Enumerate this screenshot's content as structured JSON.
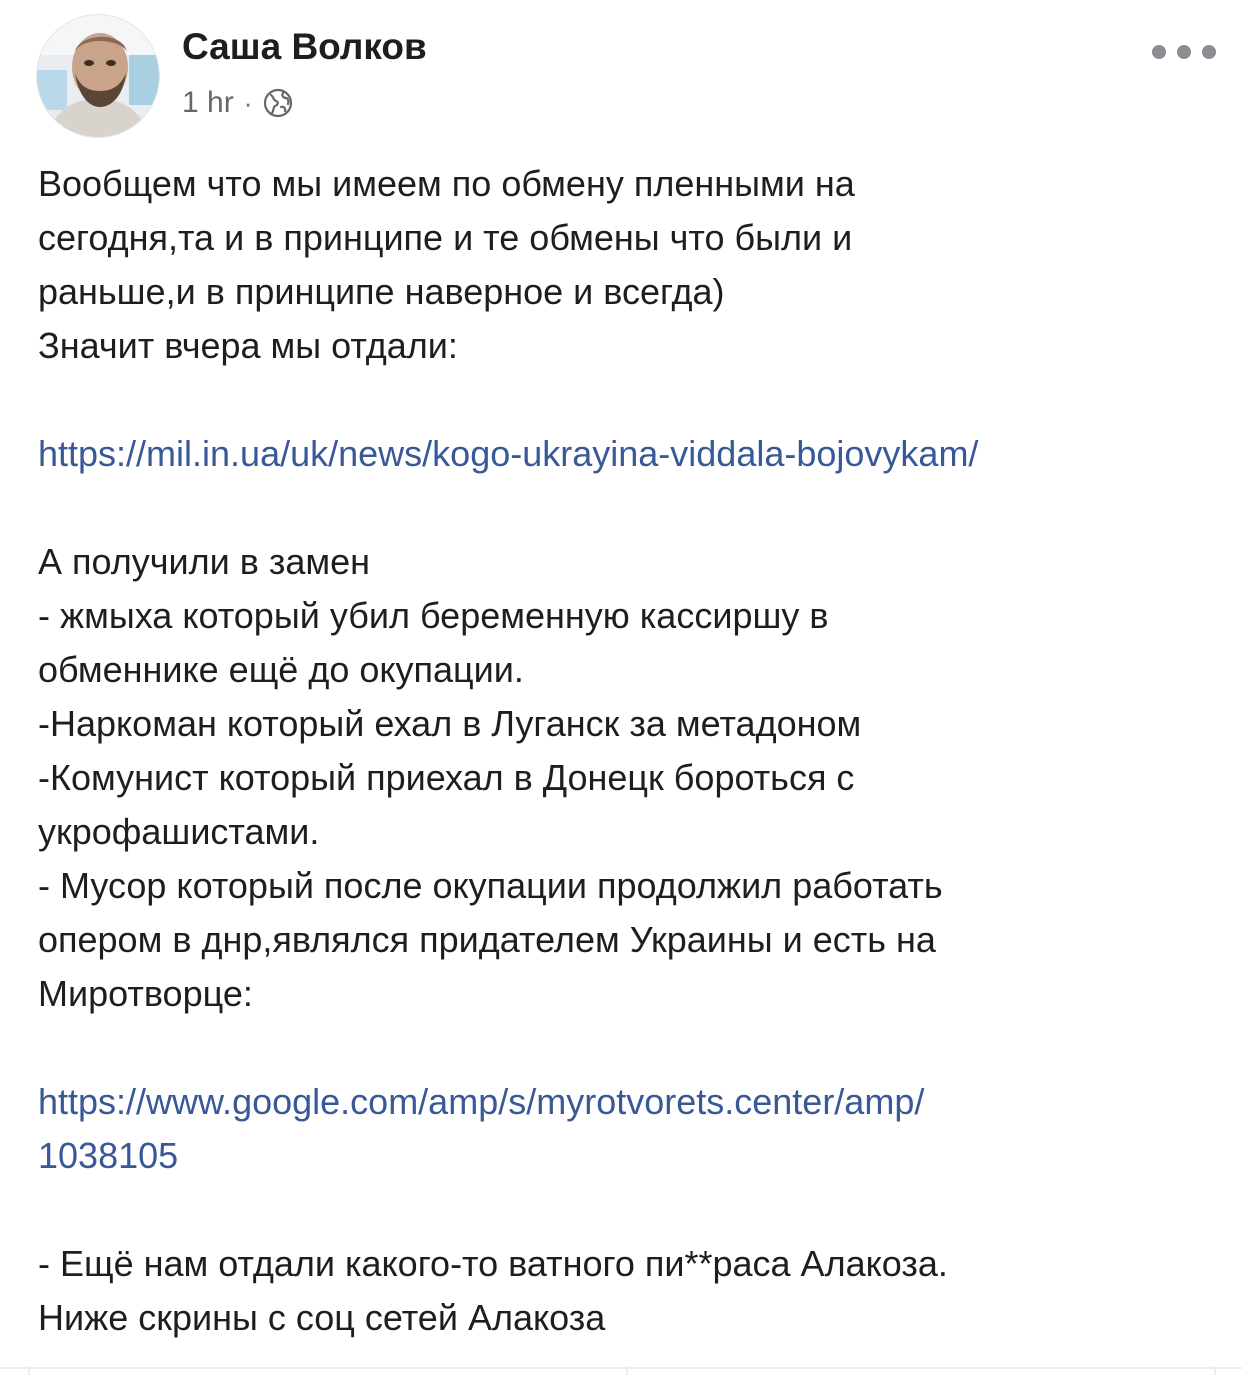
{
  "author": {
    "name": "Саша Волков",
    "avatar_icon": "profile-photo",
    "timestamp": "1 hr",
    "separator": "·",
    "privacy_icon": "globe-icon"
  },
  "menu": {
    "icon": "more-options-icon"
  },
  "post": {
    "lines": [
      "Вообщем что мы имеем по обмену пленными на",
      "сегодня,та и в принципе и те обмены что были и",
      "раньше,и в принципе наверное и всегда)",
      "Значит вчера мы отдали:",
      "",
      "https://mil.in.ua/uk/news/kogo-ukrayina-viddala-bojovykam/",
      "",
      "А получили в замен",
      "- жмыха который убил беременную кассиршу в",
      "обменнике ещё до окупации.",
      "-Наркоман который ехал в Луганск за метадоном",
      "-Комунист который приехал в Донецк бороться с",
      "укрофашистами.",
      "- Мусор который после окупации продолжил работать",
      "опером в днр,являлся придателем Украины и есть на",
      "Миротворце:",
      "",
      "https://www.google.com/amp/s/myrotvorets.center/amp/",
      "1038105",
      "",
      "- Ещё  нам отдали какого-то ватного пи**раса Алакоза.",
      "Ниже скрины с  соц сетей Алакоза"
    ]
  },
  "colors": {
    "text": "#1c1e21",
    "secondary": "#65676b",
    "link": "#385898",
    "divider": "#ebedf0"
  }
}
